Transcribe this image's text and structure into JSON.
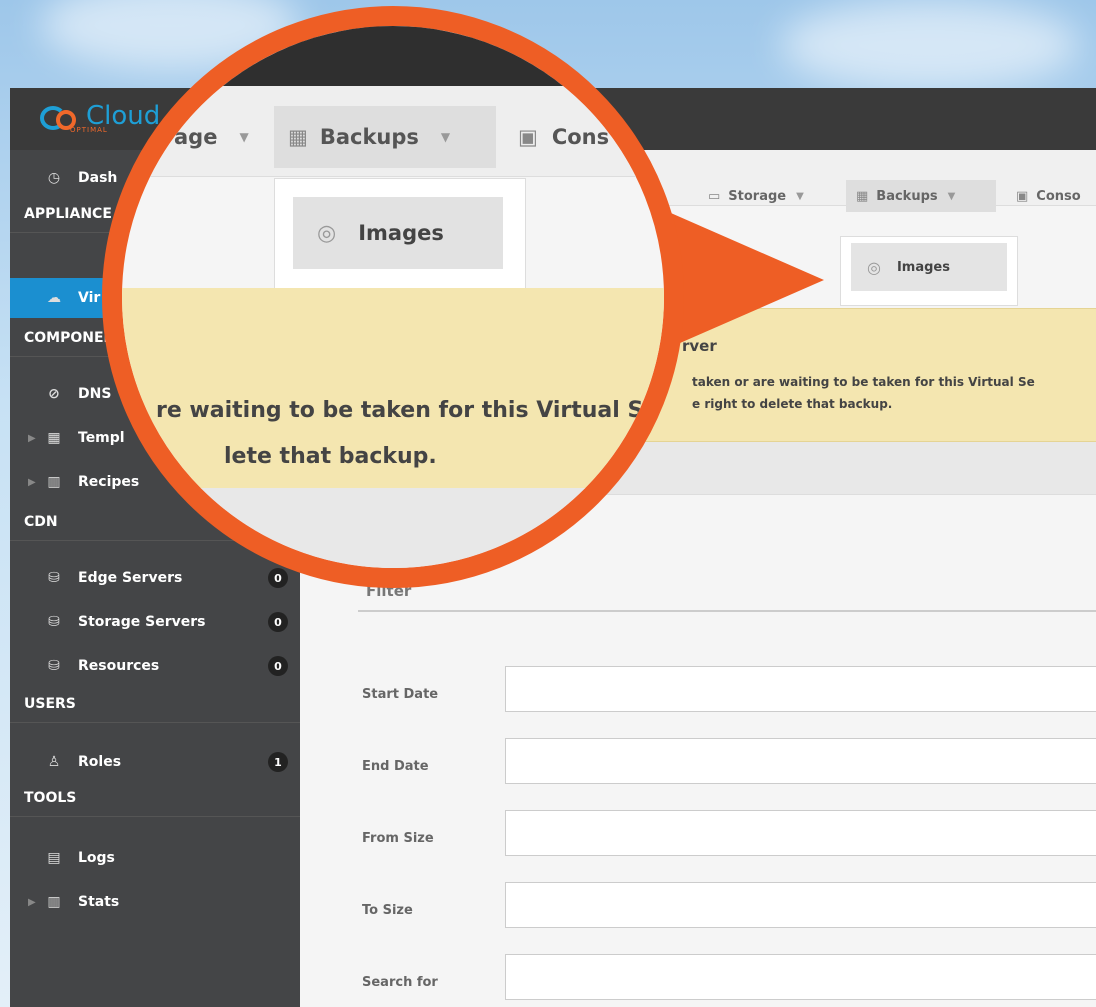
{
  "brand": {
    "name": "Cloud",
    "subtitle": "OPTIMAL"
  },
  "sidebar": {
    "dashboard": "Dash",
    "sections": [
      {
        "id": "appliances",
        "label": "APPLIANCE"
      },
      {
        "id": "components",
        "label": "COMPONEN"
      },
      {
        "id": "cdn",
        "label": "CDN"
      },
      {
        "id": "users",
        "label": "USERS"
      },
      {
        "id": "tools",
        "label": "TOOLS"
      }
    ],
    "virtual_label": "Vir",
    "dns": "DNS",
    "templates": "Templ",
    "recipes": "Recipes",
    "edge_servers": {
      "label": "Edge Servers",
      "count": "0"
    },
    "storage_servers": {
      "label": "Storage Servers",
      "count": "0"
    },
    "resources": {
      "label": "Resources",
      "count": "0"
    },
    "roles": {
      "label": "Roles",
      "count": "1"
    },
    "logs": "Logs",
    "stats": "Stats"
  },
  "tabs": {
    "storage": "Storage",
    "backups": "Backups",
    "console": "Conso"
  },
  "dropdown": {
    "images": "Images"
  },
  "alert": {
    "title": "rver",
    "text_line1": "taken or are waiting to be taken for this Virtual Se",
    "text_line2": "e right to delete that backup."
  },
  "filter": {
    "label": "Filter",
    "fields": [
      "Start Date",
      "End Date",
      "From Size",
      "To Size",
      "Search for"
    ]
  },
  "magnifier": {
    "tab_storage": "age",
    "tab_backups": "Backups",
    "tab_console": "Cons",
    "dropdown_item": "Images",
    "alert_line1": "re waiting to be taken for this Virtual Ser",
    "alert_line2": "lete that backup.",
    "sidebar_dash": "Dash",
    "sidebar_appliance": "APPLIANCE",
    "sidebar_vir": "Vir",
    "sidebar_componen": "COMPONEI",
    "sidebar_dns": "DNS",
    "sidebar_templ": "Templ",
    "sidebar_recipes": "Recipes"
  }
}
